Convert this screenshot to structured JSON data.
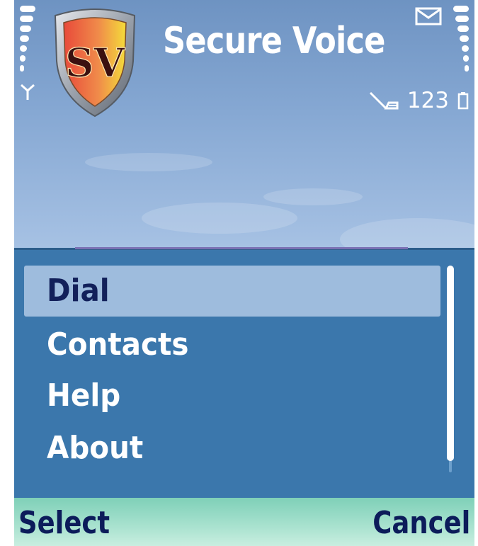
{
  "app": {
    "title": "Secure Voice",
    "logo_letters": "SV"
  },
  "status": {
    "input_mode": "123",
    "signal_icon": "antenna-icon",
    "mail_icon": "mail-icon",
    "battery_icon": "battery-icon"
  },
  "menu": {
    "items": [
      {
        "label": "Dial",
        "selected": true
      },
      {
        "label": "Contacts",
        "selected": false
      },
      {
        "label": "Help",
        "selected": false
      },
      {
        "label": "About",
        "selected": false
      }
    ]
  },
  "softkeys": {
    "left": "Select",
    "right": "Cancel"
  },
  "colors": {
    "menu_bg": "#3b77ac",
    "highlight": "#9ebcdd",
    "selected_text": "#12205a",
    "softkey_text": "#0c1c5a"
  }
}
